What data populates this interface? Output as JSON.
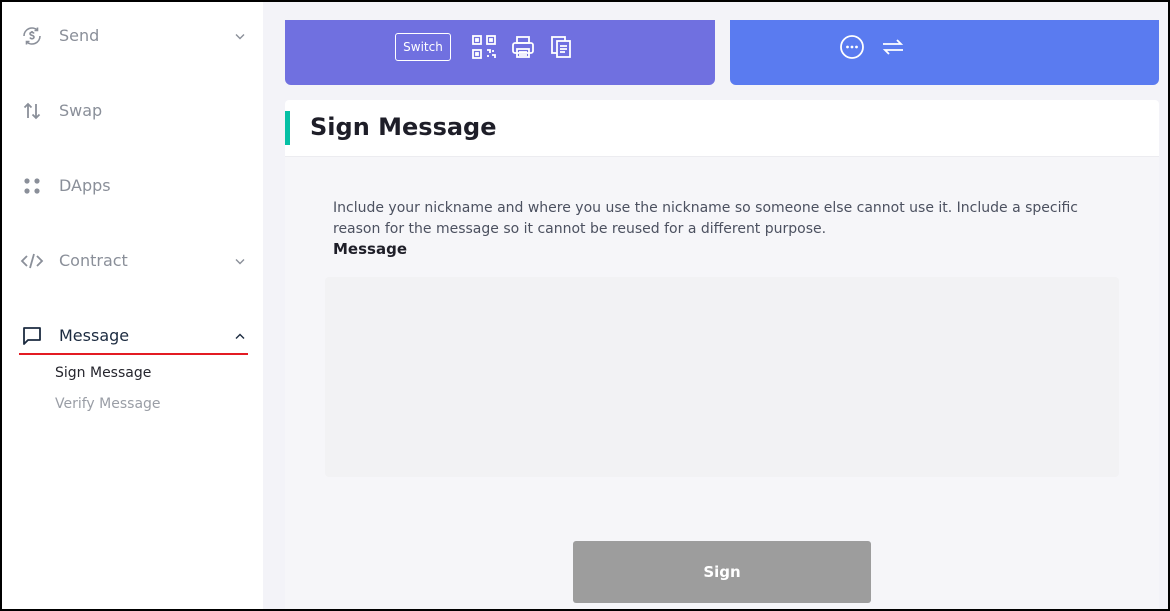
{
  "sidebar": {
    "items": [
      {
        "label": "Send",
        "icon": "send-dollar-icon",
        "has_dropdown": true
      },
      {
        "label": "Swap",
        "icon": "swap-arrows-icon",
        "has_dropdown": false
      },
      {
        "label": "DApps",
        "icon": "dapps-dots-icon",
        "has_dropdown": false
      },
      {
        "label": "Contract",
        "icon": "code-brackets-icon",
        "has_dropdown": true
      },
      {
        "label": "Message",
        "icon": "message-bubble-icon",
        "has_dropdown": true,
        "expanded": true
      }
    ],
    "sub_items": [
      {
        "label": "Sign Message",
        "current": true
      },
      {
        "label": "Verify Message",
        "current": false
      }
    ],
    "active_underline_color": "#e31b23"
  },
  "header": {
    "switch_label": "Switch",
    "left_icons": [
      "qr-code-icon",
      "print-icon",
      "copy-icon"
    ],
    "right_icons": [
      "more-options-icon",
      "refresh-arrows-icon"
    ],
    "purple_card_color": "#7070e0",
    "blue_card_color": "#5a7bf0"
  },
  "main": {
    "title": "Sign Message",
    "accent_color": "#05c0a5",
    "help_text": "Include your nickname and where you use the nickname so someone else cannot use it. Include a specific reason for the message so it cannot be reused for a different purpose.",
    "field_label": "Message",
    "message_value": "",
    "sign_label": "Sign"
  }
}
